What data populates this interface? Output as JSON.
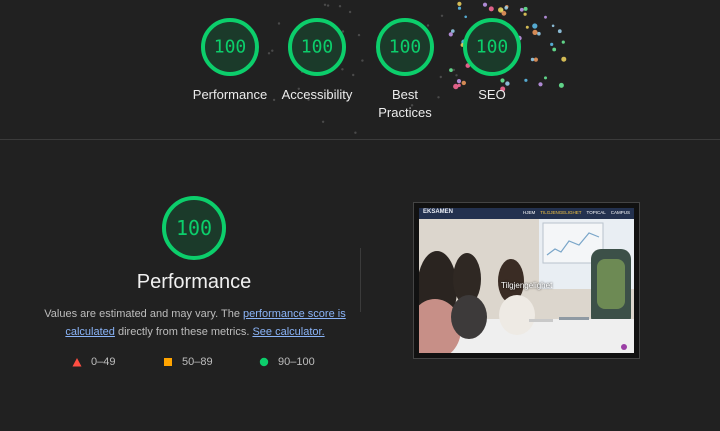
{
  "colors": {
    "pass": "#0cce6b",
    "average": "#ffa400",
    "fail": "#ff4e42",
    "link": "#8ab4f8",
    "background": "#212121"
  },
  "categories": [
    {
      "label": "Performance",
      "score": "100"
    },
    {
      "label": "Accessibility",
      "score": "100"
    },
    {
      "label": "Best Practices",
      "score": "100"
    },
    {
      "label": "SEO",
      "score": "100"
    }
  ],
  "performance": {
    "score": "100",
    "title": "Performance",
    "note_prefix": "Values are estimated and may vary. The ",
    "note_link": "performance score is calculated",
    "note_middle": " directly from these metrics. ",
    "calculator_link": "See calculator."
  },
  "legend": [
    {
      "icon": "triangle-icon",
      "range": "0–49"
    },
    {
      "icon": "square-icon",
      "range": "50–89"
    },
    {
      "icon": "circle-icon",
      "range": "90–100"
    }
  ],
  "screenshot": {
    "brand": "EKSAMEN",
    "menu": [
      "HJEM",
      "TILGJENGELIGHET",
      "TOPICAL",
      "CAMPUS"
    ],
    "caption": "Tilgjengelighet"
  }
}
